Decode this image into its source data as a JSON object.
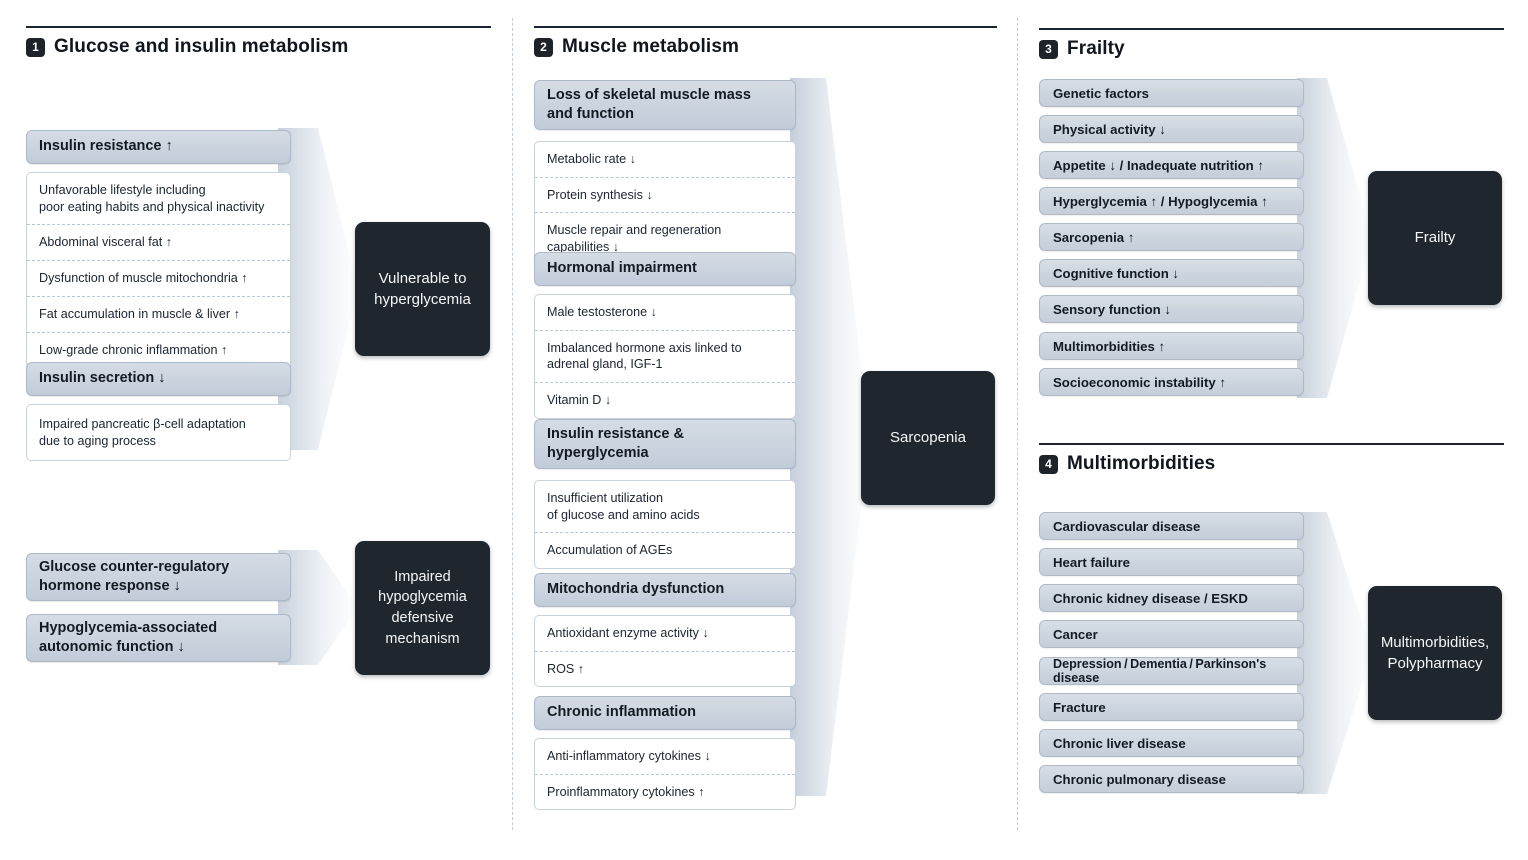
{
  "meta": {
    "accent_dark": "#20262d",
    "pill_fill": "#ccd5df",
    "divider": "#c3cbd6"
  },
  "sections": [
    {
      "number": "1",
      "title": "Glucose and insulin metabolism"
    },
    {
      "number": "2",
      "title": "Muscle metabolism"
    },
    {
      "number": "3",
      "title": "Frailty"
    },
    {
      "number": "4",
      "title": "Multimorbidities"
    }
  ],
  "col1": {
    "group_insulin_resistance": {
      "header": "Insulin resistance ↑",
      "items": [
        "Unfavorable lifestyle including\npoor eating habits and physical inactivity",
        "Abdominal visceral fat ↑",
        "Dysfunction of muscle mitochondria ↑",
        "Fat accumulation in muscle & liver ↑",
        "Low-grade chronic inflammation ↑"
      ]
    },
    "group_insulin_secretion": {
      "header": "Insulin secretion ↓",
      "items": [
        "Impaired pancreatic β-cell adaptation\ndue to aging process"
      ]
    },
    "outcome_hyperglycemia": "Vulnerable to\nhyperglycemia",
    "pills_lower": [
      "Glucose counter-regulatory\nhormone response ↓",
      "Hypoglycemia-associated\nautonomic function ↓"
    ],
    "outcome_hypoglycemia": "Impaired\nhypoglycemia\ndefensive\nmechanism"
  },
  "col2": {
    "groups": [
      {
        "header": "Loss of skeletal muscle mass\nand function",
        "items": [
          "Metabolic rate ↓",
          "Protein synthesis ↓",
          "Muscle repair and regeneration capabilities ↓"
        ]
      },
      {
        "header": "Hormonal impairment",
        "items": [
          "Male testosterone ↓",
          "Imbalanced hormone axis linked to\nadrenal gland, IGF-1",
          "Vitamin D ↓"
        ]
      },
      {
        "header": "Insulin resistance &\nhyperglycemia",
        "items": [
          "Insufficient utilization\nof glucose and amino acids",
          "Accumulation of AGEs"
        ]
      },
      {
        "header": "Mitochondria dysfunction",
        "items": [
          "Antioxidant enzyme activity ↓",
          "ROS ↑"
        ]
      },
      {
        "header": "Chronic inflammation",
        "items": [
          "Anti-inflammatory cytokines ↓",
          "Proinflammatory cytokines ↑"
        ]
      }
    ],
    "outcome": "Sarcopenia"
  },
  "col3": {
    "pills": [
      "Genetic factors",
      "Physical activity ↓",
      "Appetite ↓ / Inadequate nutrition ↑",
      "Hyperglycemia ↑ / Hypoglycemia ↑",
      "Sarcopenia ↑",
      "Cognitive function ↓",
      "Sensory function ↓",
      "Multimorbidities ↑",
      "Socioeconomic instability ↑"
    ],
    "outcome": "Frailty"
  },
  "col4": {
    "pills": [
      "Cardiovascular disease",
      "Heart failure",
      "Chronic kidney disease / ESKD",
      "Cancer",
      "Depression / Dementia / Parkinson's disease",
      "Fracture",
      "Chronic liver disease",
      "Chronic pulmonary disease"
    ],
    "outcome": "Multimorbidities,\nPolypharmacy"
  }
}
